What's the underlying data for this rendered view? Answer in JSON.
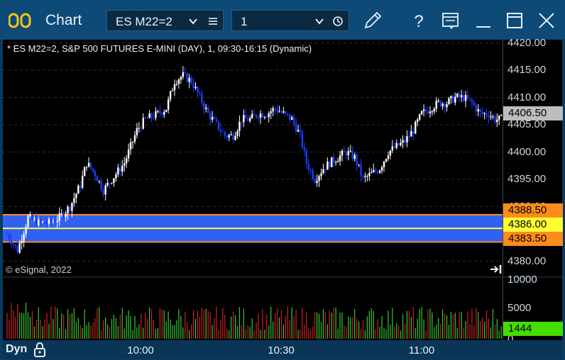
{
  "window": {
    "app_title": "Chart",
    "symbol": "ES M22=2",
    "interval": "1",
    "icons": [
      "app-logo-icon",
      "chevron-down-icon",
      "menu-icon",
      "chevron-down-icon",
      "clock-icon",
      "pencil-icon",
      "help-icon",
      "form-icon",
      "minimize-icon",
      "maximize-icon",
      "close-icon"
    ]
  },
  "chart": {
    "label": "* ES M22=2, S&P 500 FUTURES E-MINI (DAY), 1, 09:30-16:15 (Dynamic)",
    "copyright": "© eSignal, 2022",
    "price_ticks": [
      "4420.00",
      "4415.00",
      "4410.00",
      "4405.00",
      "4400.00",
      "4395.00",
      "4390.00",
      "4385.00",
      "4380.00"
    ],
    "price_tags": [
      {
        "label": "4406.50",
        "bg": "#bdbdbd",
        "fg": "#000000"
      },
      {
        "label": "4388.50",
        "bg": "#ff8c1a",
        "fg": "#000000"
      },
      {
        "label": "4386.00",
        "bg": "#ffff33",
        "fg": "#000000"
      },
      {
        "label": "4383.50",
        "bg": "#ff8c1a",
        "fg": "#000000"
      }
    ],
    "volume_ticks": [
      "10000",
      "5000",
      "0"
    ],
    "volume_tag": {
      "label": "1444",
      "bg": "#44dd00",
      "fg": "#000000"
    },
    "time_labels": [
      "10:00",
      "10:30",
      "11:00"
    ],
    "status": "Dyn",
    "colors": {
      "up": "#ffffff",
      "down": "#1a3cff",
      "vol_up": "#33cc33",
      "vol_down": "#cc2222",
      "band": "#3366ff",
      "band_edge": "#ff8c1a",
      "midline": "#ffff33"
    }
  },
  "chart_data": {
    "type": "candlestick",
    "title": "* ES M22=2, S&P 500 FUTURES E-MINI (DAY), 1, 09:30-16:15 (Dynamic)",
    "y_range": [
      4377,
      4421
    ],
    "y_ticks": [
      4420,
      4415,
      4410,
      4405,
      4400,
      4395,
      4390,
      4385,
      4380
    ],
    "x_labels": [
      "10:00",
      "10:30",
      "11:00"
    ],
    "band": {
      "upper": 4388.5,
      "mid": 4386.0,
      "lower": 4383.5
    },
    "last_price": 4406.5,
    "volume_last": 1444,
    "volume_range": [
      0,
      11000
    ],
    "close_path": [
      [
        0,
        4385
      ],
      [
        5,
        4382
      ],
      [
        10,
        4388
      ],
      [
        15,
        4387
      ],
      [
        20,
        4387
      ],
      [
        25,
        4388
      ],
      [
        30,
        4390
      ],
      [
        35,
        4394
      ],
      [
        38,
        4398
      ],
      [
        42,
        4396
      ],
      [
        46,
        4393
      ],
      [
        50,
        4395
      ],
      [
        56,
        4398
      ],
      [
        62,
        4404
      ],
      [
        66,
        4406
      ],
      [
        72,
        4407
      ],
      [
        76,
        4408
      ],
      [
        80,
        4413
      ],
      [
        84,
        4414
      ],
      [
        88,
        4413
      ],
      [
        92,
        4410
      ],
      [
        96,
        4407
      ],
      [
        100,
        4405
      ],
      [
        104,
        4403
      ],
      [
        108,
        4403
      ],
      [
        112,
        4406
      ],
      [
        116,
        4406
      ],
      [
        120,
        4407
      ],
      [
        124,
        4407
      ],
      [
        128,
        4408
      ],
      [
        132,
        4407
      ],
      [
        136,
        4406
      ],
      [
        140,
        4403
      ],
      [
        143,
        4398
      ],
      [
        147,
        4395
      ],
      [
        151,
        4397
      ],
      [
        154,
        4398
      ],
      [
        158,
        4399
      ],
      [
        162,
        4400
      ],
      [
        166,
        4399
      ],
      [
        170,
        4395
      ],
      [
        174,
        4396
      ],
      [
        178,
        4397
      ],
      [
        182,
        4400
      ],
      [
        186,
        4401
      ],
      [
        190,
        4402
      ],
      [
        194,
        4404
      ],
      [
        198,
        4407
      ],
      [
        202,
        4408
      ],
      [
        206,
        4409
      ],
      [
        210,
        4409
      ],
      [
        214,
        4410
      ],
      [
        218,
        4410
      ],
      [
        222,
        4409
      ],
      [
        226,
        4407
      ],
      [
        230,
        4407
      ],
      [
        233,
        4406
      ],
      [
        236,
        4406
      ]
    ]
  }
}
